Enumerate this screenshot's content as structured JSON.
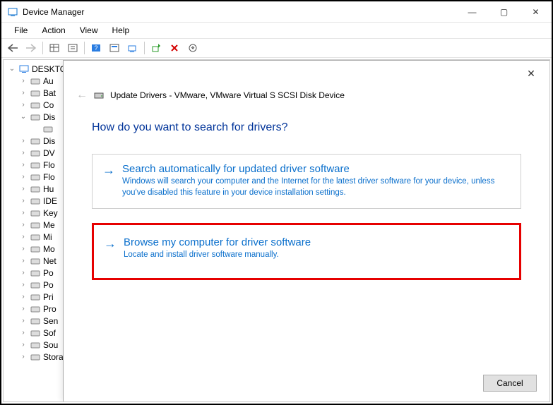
{
  "window": {
    "title": "Device Manager",
    "controls": {
      "min": "—",
      "max": "▢",
      "close": "✕"
    }
  },
  "menu": {
    "file": "File",
    "action": "Action",
    "view": "View",
    "help": "Help"
  },
  "tree": {
    "root": "DESKTO",
    "items": [
      "Au",
      "Bat",
      "Co",
      "Dis",
      "Dis",
      "DV",
      "Flo",
      "Flo",
      "Hu",
      "IDE",
      "Key",
      "Me",
      "Mi",
      "Mo",
      "Net",
      "Po",
      "Po",
      "Pri",
      "Pro",
      "Sen",
      "Sof",
      "Sou",
      "Storage controllers"
    ]
  },
  "dialog": {
    "title": "Update Drivers - VMware, VMware Virtual S SCSI Disk Device",
    "heading": "How do you want to search for drivers?",
    "option1": {
      "title": "Search automatically for updated driver software",
      "desc": "Windows will search your computer and the Internet for the latest driver software for your device, unless you've disabled this feature in your device installation settings."
    },
    "option2": {
      "title": "Browse my computer for driver software",
      "desc": "Locate and install driver software manually."
    },
    "cancel": "Cancel"
  }
}
